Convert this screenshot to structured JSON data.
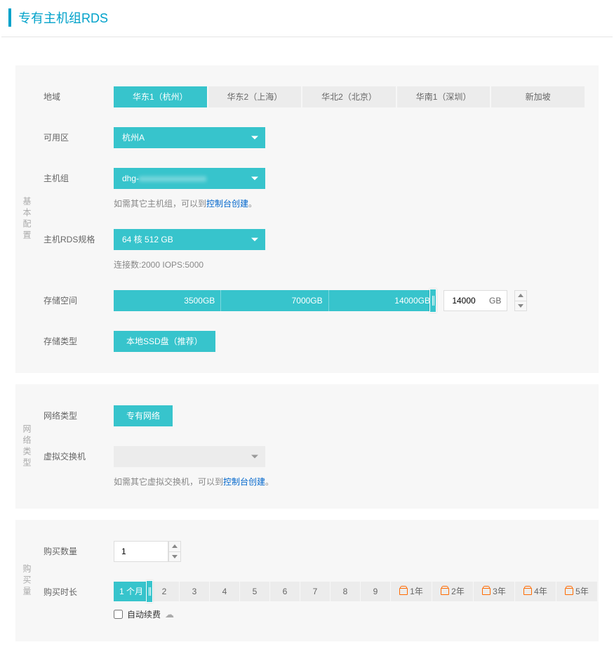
{
  "page": {
    "title": "专有主机组RDS"
  },
  "panel_labels": {
    "basic": "基本配置",
    "network": "网络类型",
    "purchase": "购买量"
  },
  "basic": {
    "region": {
      "label": "地域",
      "options": [
        "华东1（杭州）",
        "华东2（上海）",
        "华北2（北京）",
        "华南1（深圳）",
        "新加坡"
      ],
      "selectedIndex": 0
    },
    "zone": {
      "label": "可用区",
      "value": "杭州A"
    },
    "hostgroup": {
      "label": "主机组",
      "value_prefix": "dhg-",
      "value_masked": "xxxxxxxxxxxxxxxx",
      "hint_prefix": "如需其它主机组，可以到",
      "hint_link": "控制台创建",
      "hint_suffix": "。"
    },
    "spec": {
      "label": "主机RDS规格",
      "value": "64 核 512 GB",
      "sub": "连接数:2000 IOPS:5000"
    },
    "storage": {
      "label": "存储空间",
      "ticks": [
        "3500GB",
        "7000GB",
        "14000GB"
      ],
      "value": "14000",
      "unit": "GB"
    },
    "storage_type": {
      "label": "存储类型",
      "value": "本地SSD盘（推荐）"
    }
  },
  "network": {
    "type": {
      "label": "网络类型",
      "value": "专有网络"
    },
    "vswitch": {
      "label": "虚拟交换机",
      "value": "",
      "hint_prefix": "如需其它虚拟交换机，可以到",
      "hint_link": "控制台创建",
      "hint_suffix": "。"
    }
  },
  "purchase": {
    "qty": {
      "label": "购买数量",
      "value": "1"
    },
    "duration": {
      "label": "购买时长",
      "active": "1 个月",
      "months": [
        "2",
        "3",
        "4",
        "5",
        "6",
        "7",
        "8",
        "9"
      ],
      "years": [
        "1年",
        "2年",
        "3年",
        "4年",
        "5年"
      ]
    },
    "auto_renew": {
      "label": "自动续费"
    }
  }
}
